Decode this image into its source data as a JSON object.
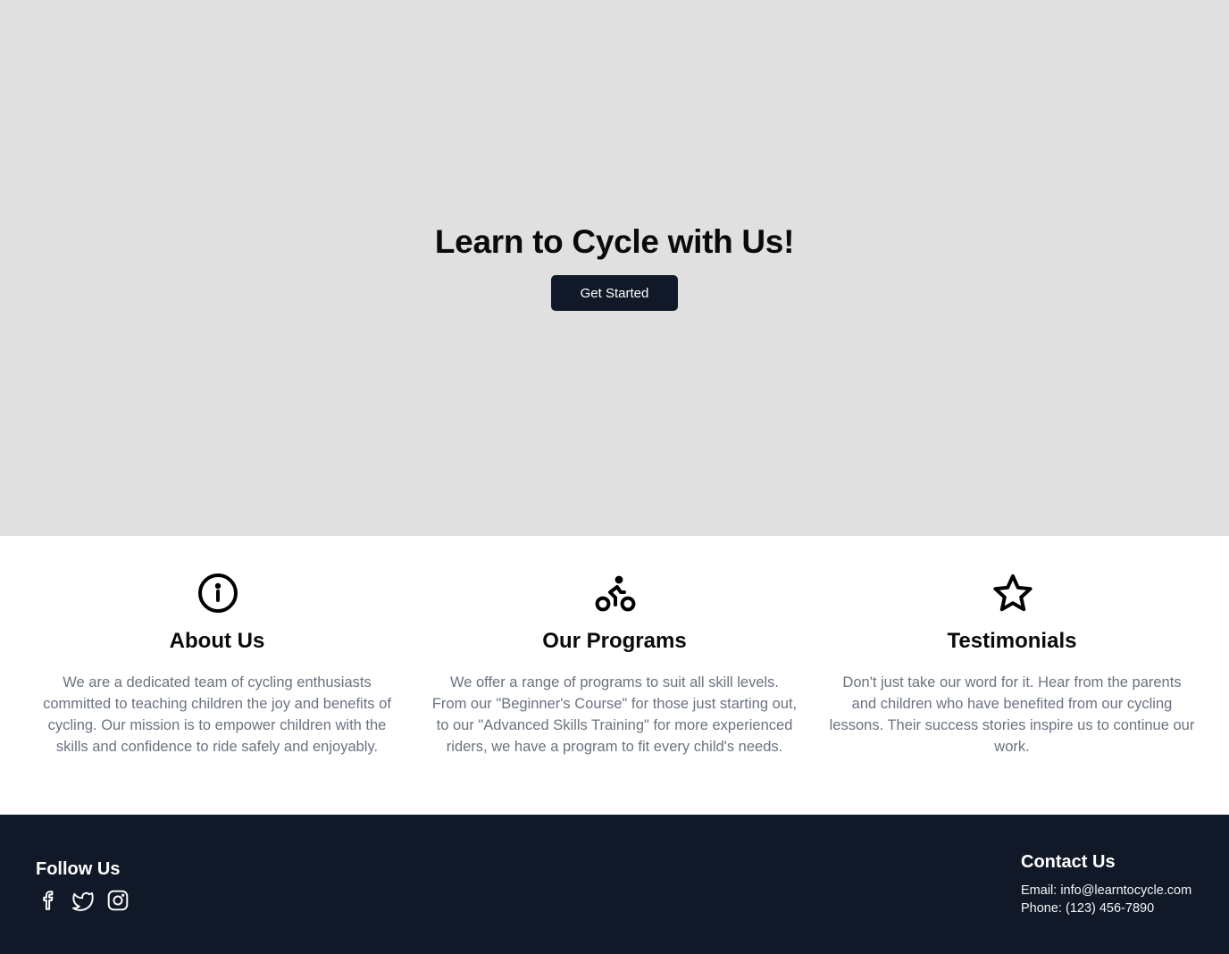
{
  "hero": {
    "title": "Learn to Cycle with Us!",
    "cta_label": "Get Started",
    "background_color": "#e0e0e0",
    "button_color": "#111827"
  },
  "features": [
    {
      "icon": "info-circle-icon",
      "title": "About Us",
      "text": "We are a dedicated team of cycling enthusiasts committed to teaching children the joy and benefits of cycling. Our mission is to empower children with the skills and confidence to ride safely and enjoyably."
    },
    {
      "icon": "bicycle-rider-icon",
      "title": "Our Programs",
      "text": "We offer a range of programs to suit all skill levels. From our \"Beginner's Course\" for those just starting out, to our \"Advanced Skills Training\" for more experienced riders, we have a program to fit every child's needs."
    },
    {
      "icon": "star-icon",
      "title": "Testimonials",
      "text": "Don't just take our word for it. Hear from the parents and children who have benefited from our cycling lessons. Their success stories inspire us to continue our work."
    }
  ],
  "footer": {
    "background_color": "#111827",
    "follow_title": "Follow Us",
    "social_icons": [
      "facebook-icon",
      "twitter-icon",
      "instagram-icon"
    ],
    "contact_title": "Contact Us",
    "email_line": "Email: info@learntocycle.com",
    "phone_line": "Phone: (123) 456-7890"
  }
}
